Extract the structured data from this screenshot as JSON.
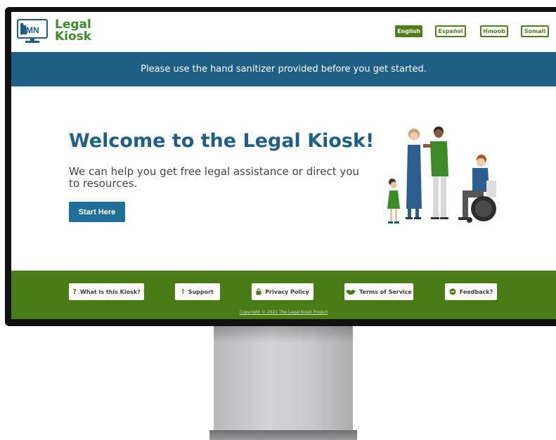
{
  "logo": {
    "mark": "MN",
    "line1": "Legal",
    "line2": "Kiosk"
  },
  "languages": [
    {
      "label": "English",
      "active": true
    },
    {
      "label": "Español",
      "active": false
    },
    {
      "label": "Hmoob",
      "active": false
    },
    {
      "label": "Somali",
      "active": false
    }
  ],
  "banner": {
    "text": "Please use the hand sanitizer provided before you get started."
  },
  "main": {
    "title": "Welcome to the Legal Kiosk!",
    "subtitle": "We can help you get free legal assistance or direct you to resources.",
    "start_button": "Start Here"
  },
  "footer": {
    "buttons": [
      {
        "icon": "question-icon",
        "glyph": "?",
        "label": "What is this Kiosk?"
      },
      {
        "icon": "exclamation-icon",
        "glyph": "!",
        "label": "Support"
      },
      {
        "icon": "lock-icon",
        "glyph": "",
        "label": "Privacy Policy"
      },
      {
        "icon": "handshake-icon",
        "glyph": "",
        "label": "Terms of Service"
      },
      {
        "icon": "chat-icon",
        "glyph": "",
        "label": "Feedback?"
      }
    ],
    "copyright": "Copyright © 2021 The Legal Kiosk Project"
  },
  "colors": {
    "brand_green": "#4a7c15",
    "brand_blue": "#1f5f86",
    "logo_green": "#3d8a2b"
  }
}
